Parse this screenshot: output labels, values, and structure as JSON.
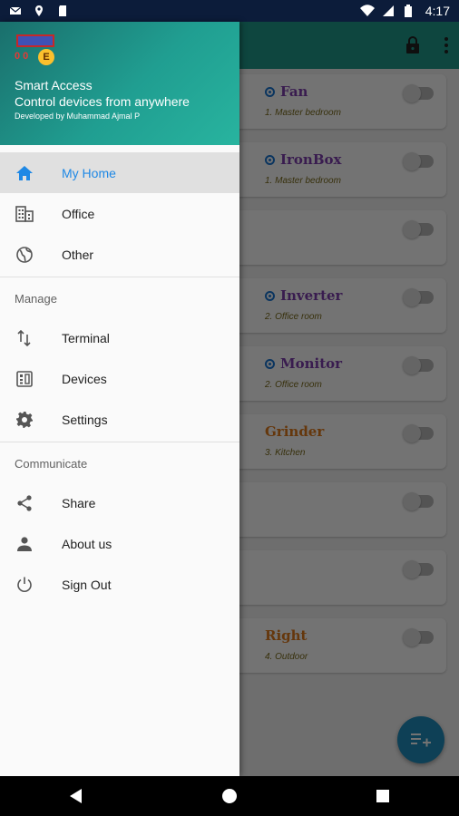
{
  "status_bar": {
    "time": "4:17"
  },
  "drawer": {
    "header": {
      "logo_text": "E",
      "app_name": "Smart Access",
      "tagline": "Control devices from anywhere",
      "developer": "Developed by Muhammad Ajmal P"
    },
    "primary_items": [
      {
        "label": "My Home",
        "icon": "home-icon",
        "active": true
      },
      {
        "label": "Office",
        "icon": "office-building-icon",
        "active": false
      },
      {
        "label": "Other",
        "icon": "globe-icon",
        "active": false
      }
    ],
    "manage": {
      "header": "Manage",
      "items": [
        {
          "label": "Terminal",
          "icon": "swap-vertical-icon"
        },
        {
          "label": "Devices",
          "icon": "devices-icon"
        },
        {
          "label": "Settings",
          "icon": "gear-icon"
        }
      ]
    },
    "communicate": {
      "header": "Communicate",
      "items": [
        {
          "label": "Share",
          "icon": "share-icon"
        },
        {
          "label": "About us",
          "icon": "person-icon"
        },
        {
          "label": "Sign Out",
          "icon": "power-icon"
        }
      ]
    }
  },
  "background": {
    "cards": [
      {
        "name": "Fan",
        "sub": "1. Master bedroom",
        "color": "#7e3fb0",
        "dot": true
      },
      {
        "name": "IronBox",
        "sub": "1. Master bedroom",
        "color": "#7e3fb0",
        "dot": true
      },
      {
        "name": "",
        "sub": "",
        "color": "#7e3fb0",
        "dot": false
      },
      {
        "name": "Inverter",
        "sub": "2. Office room",
        "color": "#7e3fb0",
        "dot": true
      },
      {
        "name": "Monitor",
        "sub": "2. Office room",
        "color": "#7e3fb0",
        "dot": true
      },
      {
        "name": "Grinder",
        "sub": "3. Kitchen",
        "color": "#e07a1b",
        "dot": false
      },
      {
        "name": "",
        "sub": "",
        "color": "#7e3fb0",
        "dot": false
      },
      {
        "name": "",
        "sub": "",
        "color": "#7e3fb0",
        "dot": false
      },
      {
        "name": "Right",
        "sub": "4. Outdoor",
        "color": "#e07a1b",
        "dot": false
      }
    ]
  },
  "colors": {
    "accent": "#1e88e5",
    "header": "#209e91",
    "fab": "#1f8fbf"
  }
}
